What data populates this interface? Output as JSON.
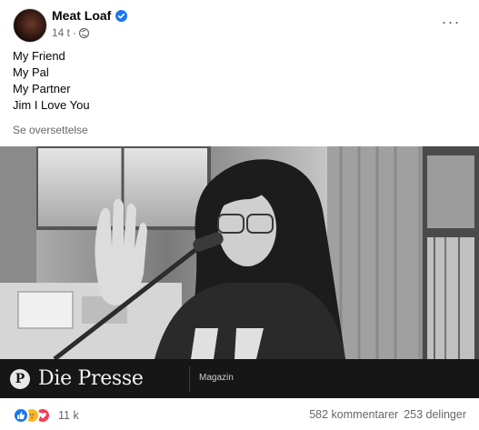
{
  "post": {
    "page_name": "Meat Loaf",
    "timestamp": "14 t",
    "separator": "·",
    "more_label": "···",
    "lines": [
      "My Friend",
      "My Pal",
      "My Partner",
      "Jim I Love You"
    ],
    "translate_label": "Se oversettelse"
  },
  "link_preview": {
    "brand_mark": "P",
    "brand_name": "Die Presse",
    "section": "Magazin"
  },
  "engagement": {
    "reactions_count": "11 k",
    "comments": "582 kommentarer",
    "shares": "253 delinger"
  },
  "colors": {
    "accent": "#1877f2",
    "secondary_text": "#65676b",
    "footer_bg": "#161616"
  },
  "icons": {
    "verified": "verified-badge-icon",
    "globe": "globe-icon",
    "more": "more-icon"
  }
}
